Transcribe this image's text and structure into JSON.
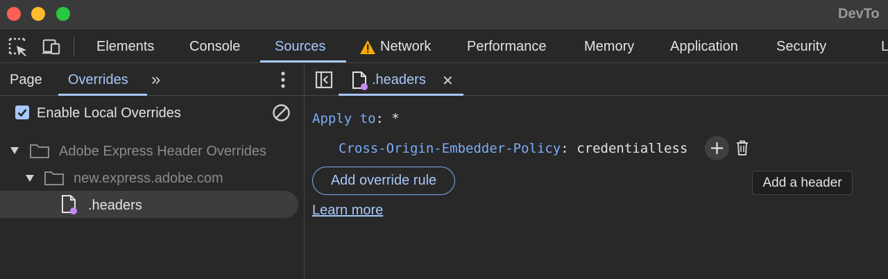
{
  "window": {
    "title": "DevTo"
  },
  "main_tabs": [
    {
      "label": "Elements"
    },
    {
      "label": "Console"
    },
    {
      "label": "Sources"
    },
    {
      "label": "Network"
    },
    {
      "label": "Performance"
    },
    {
      "label": "Memory"
    },
    {
      "label": "Application"
    },
    {
      "label": "Security"
    },
    {
      "label": "L"
    }
  ],
  "selected_main_tab": "Sources",
  "left_panel": {
    "tabs": [
      {
        "label": "Page"
      },
      {
        "label": "Overrides"
      }
    ],
    "selected_tab": "Overrides",
    "more_tabs_glyph": "»",
    "enable_overrides": {
      "label": "Enable Local Overrides",
      "checked": true
    },
    "tree": [
      {
        "label": "Adobe Express Header Overrides",
        "type": "folder",
        "expanded": true
      },
      {
        "label": "new.express.adobe.com",
        "type": "folder",
        "expanded": true
      },
      {
        "label": ".headers",
        "type": "file",
        "selected": true
      }
    ]
  },
  "editor": {
    "open_tab": {
      "label": ".headers",
      "close_glyph": "✕"
    },
    "apply_to_label": "Apply to",
    "apply_to_value": "*",
    "header": {
      "name": "Cross-Origin-Embedder-Policy",
      "value": "credentialless"
    },
    "add_rule_label": "Add override rule",
    "learn_more_label": "Learn more",
    "tooltip": "Add a header"
  },
  "colors": {
    "accent": "#a8c7fa",
    "code_key": "#7cacf8",
    "warning": "#f9ab00",
    "file_badge": "#c58af9"
  }
}
